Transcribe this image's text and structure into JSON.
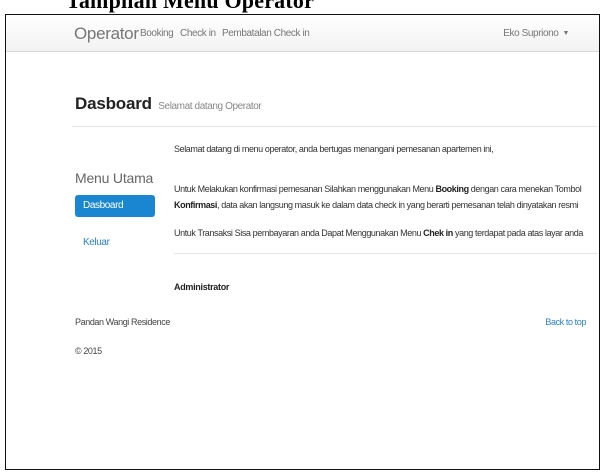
{
  "caption": "Tampilan Menu Operator",
  "navbar": {
    "brand": "Operator",
    "links": [
      "Booking",
      "Check in",
      "Pembatalan Check in"
    ],
    "user_name": "Eko Suprionо",
    "user_caret": "▼"
  },
  "page": {
    "title": "Dasboard",
    "subtitle": "Selamat datang Operator"
  },
  "sidebar": {
    "title": "Menu Utama",
    "items": [
      {
        "label": "Dasboard",
        "active": true
      },
      {
        "label": "Keluar",
        "active": false
      }
    ]
  },
  "content": {
    "p1": "Selamat datang di menu operator, anda bertugas menangani pemesanan apartemen ini,",
    "p2_pre": "Untuk Melakukan konfirmasi pemesanan Silahkan menggunakan Menu ",
    "p2_b1": "Booking",
    "p2_mid": " dengan cara menekan Tombol ",
    "p2_b2": "Konfirmasi",
    "p2_post": ", data akan langsung masuk ke dalam data check in yang berarti pemesanan telah dinyatakan resmi",
    "p3_pre": "Untuk Transaksi Sisa pembayaran anda Dapat Menggunakan Menu ",
    "p3_b": "Chek in",
    "p3_post": " yang terdapat pada atas layar anda",
    "signature": "Administrator"
  },
  "footer": {
    "company": "Pandan Wangi Residence",
    "copyright": "© 2015",
    "back_to_top": "Back to top"
  },
  "colors": {
    "accent": "#1a86d1",
    "link": "#2a7fc8",
    "navbar_bg": "#f7f7f7"
  }
}
